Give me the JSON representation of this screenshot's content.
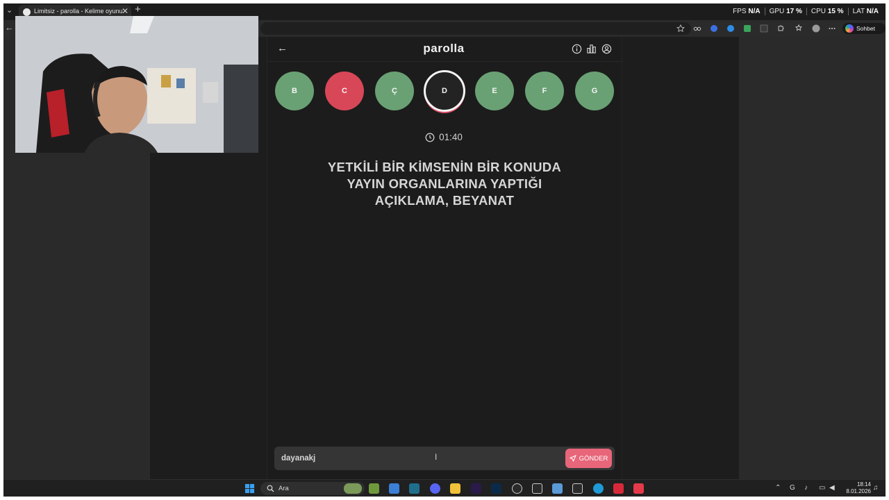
{
  "browser": {
    "tab_title": "Limitsiz - parolla - Kelime oyunu",
    "tab_close": "✕",
    "new_tab": "+",
    "copilot_label": "Sohbet et"
  },
  "overlay_stats": [
    {
      "label": "FPS",
      "value": "N/A"
    },
    {
      "label": "GPU",
      "value": "17 %"
    },
    {
      "label": "CPU",
      "value": "15 %"
    },
    {
      "label": "LAT",
      "value": "N/A"
    }
  ],
  "app": {
    "brand": "parolla",
    "letters": [
      {
        "letter": "B",
        "state": "correct"
      },
      {
        "letter": "C",
        "state": "wrong"
      },
      {
        "letter": "Ç",
        "state": "correct"
      },
      {
        "letter": "D",
        "state": "current"
      },
      {
        "letter": "E",
        "state": "correct"
      },
      {
        "letter": "F",
        "state": "correct"
      },
      {
        "letter": "G",
        "state": "correct"
      }
    ],
    "timer": "01:40",
    "question_lines": [
      "YETKİLİ BİR KİMSENİN BİR KONUDA",
      "YAYIN ORGANLARINA YAPTIĞI",
      "AÇIKLAMA, BEYANAT"
    ],
    "answer_value": "dayanakj",
    "send_label": "GÖNDER"
  },
  "taskbar": {
    "search_label": "Ara",
    "time": "18:14",
    "date": "8.01.2026"
  },
  "colors": {
    "correct": "#6aa174",
    "wrong": "#d84758",
    "accent": "#e8667a"
  }
}
